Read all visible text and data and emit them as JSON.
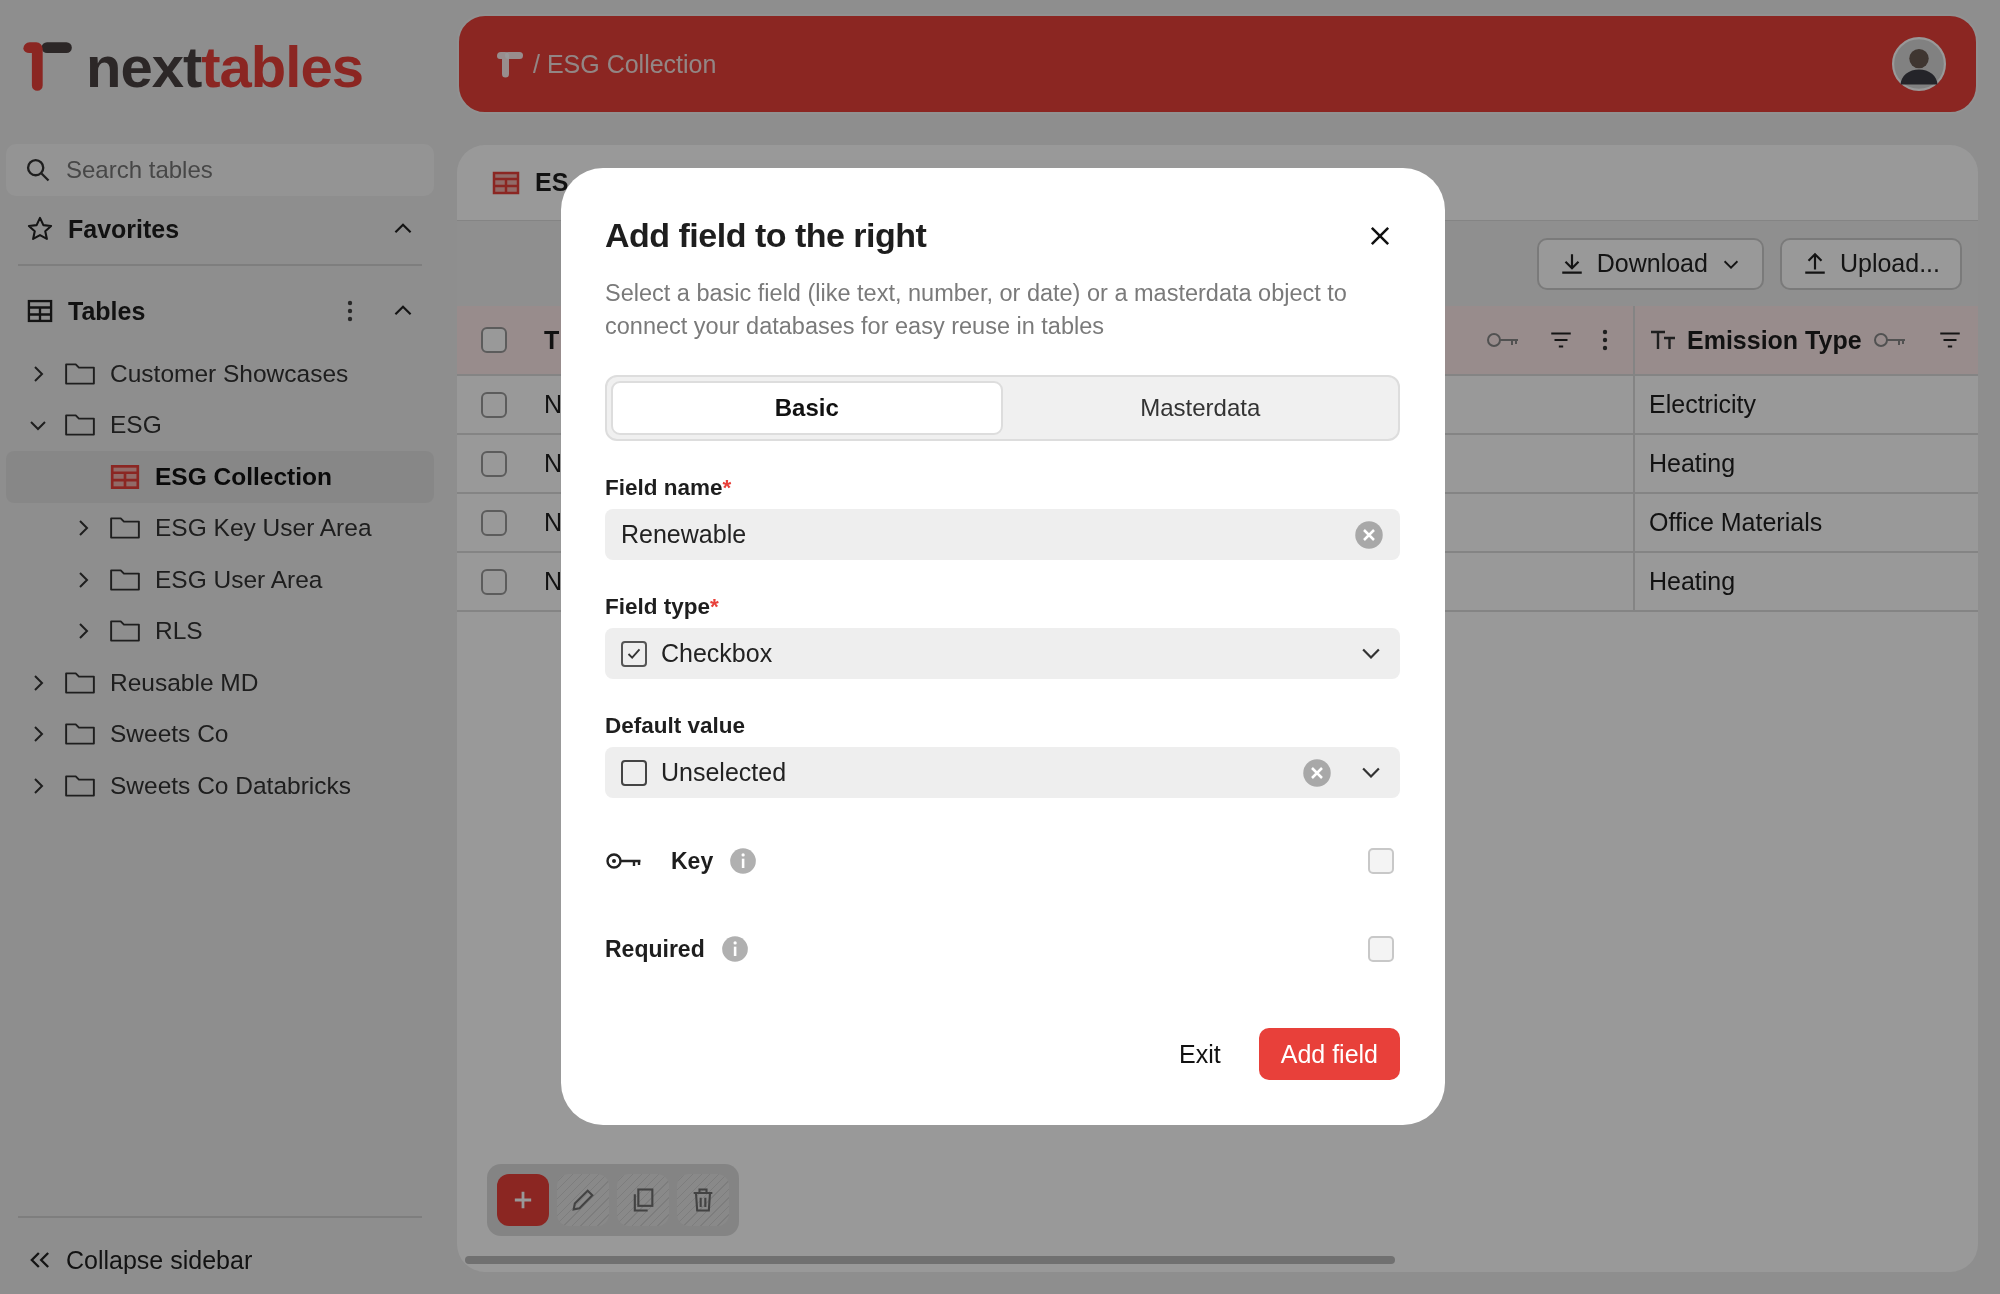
{
  "logo": {
    "prefix": "next",
    "suffix": "tables"
  },
  "sidebar": {
    "search": {
      "placeholder": "Search tables"
    },
    "favorites": {
      "label": "Favorites",
      "expanded": true
    },
    "tables": {
      "label": "Tables",
      "expanded": true,
      "items": [
        {
          "label": "Customer Showcases",
          "kind": "folder",
          "expanded": false,
          "selected": false
        },
        {
          "label": "ESG",
          "kind": "folder",
          "expanded": true,
          "selected": false,
          "children": [
            {
              "label": "ESG Collection",
              "kind": "table",
              "selected": true
            },
            {
              "label": "ESG Key User Area",
              "kind": "folder",
              "expanded": false,
              "selected": false
            },
            {
              "label": "ESG User Area",
              "kind": "folder",
              "expanded": false,
              "selected": false
            },
            {
              "label": "RLS",
              "kind": "folder",
              "expanded": false,
              "selected": false
            }
          ]
        },
        {
          "label": "Reusable MD",
          "kind": "folder",
          "expanded": false,
          "selected": false
        },
        {
          "label": "Sweets Co",
          "kind": "folder",
          "expanded": false,
          "selected": false
        },
        {
          "label": "Sweets Co Databricks",
          "kind": "folder",
          "expanded": false,
          "selected": false
        }
      ]
    },
    "collapse": "Collapse sidebar"
  },
  "header": {
    "breadcrumb": "/ ESG Collection"
  },
  "table_view": {
    "title": "ES",
    "buttons": [
      {
        "label": "Download",
        "kind": "download"
      },
      {
        "label": "Upload...",
        "kind": "upload"
      }
    ],
    "header_checked": false,
    "columns": [
      {
        "label": "T"
      },
      {
        "label": "Emission Type"
      }
    ],
    "rows": [
      {
        "checked": false,
        "cells": [
          "N",
          "Electricity"
        ]
      },
      {
        "checked": false,
        "cells": [
          "N",
          "Heating"
        ]
      },
      {
        "checked": false,
        "cells": [
          "N",
          "Office Materials"
        ]
      },
      {
        "checked": false,
        "cells": [
          "N",
          "Heating"
        ]
      }
    ],
    "actions": [
      {
        "kind": "add",
        "disabled": false
      },
      {
        "kind": "edit",
        "disabled": true
      },
      {
        "kind": "copy",
        "disabled": true
      },
      {
        "kind": "delete",
        "disabled": true
      }
    ]
  },
  "dialog": {
    "title": "Add field to the right",
    "description": "Select a basic field (like text, number, or date) or a masterdata object to connect your databases for easy reuse in tables",
    "required_mark": "*",
    "tabs": [
      {
        "label": "Basic",
        "selected": true
      },
      {
        "label": "Masterdata",
        "selected": false
      }
    ],
    "fields": [
      {
        "label": "Field name",
        "required": true,
        "kind": "text",
        "value": "Renewable"
      },
      {
        "label": "Field type",
        "required": true,
        "kind": "select",
        "value": "Checkbox",
        "checked": true
      },
      {
        "label": "Default value",
        "required": false,
        "kind": "select-clear",
        "value": "Unselected",
        "checked": false
      }
    ],
    "toggles": [
      {
        "label": "Key",
        "kind": "key",
        "checked": false
      },
      {
        "label": "Required",
        "kind": "plain",
        "checked": false
      }
    ],
    "buttons": [
      {
        "label": "Exit",
        "kind": "secondary"
      },
      {
        "label": "Add field",
        "kind": "primary"
      }
    ]
  }
}
